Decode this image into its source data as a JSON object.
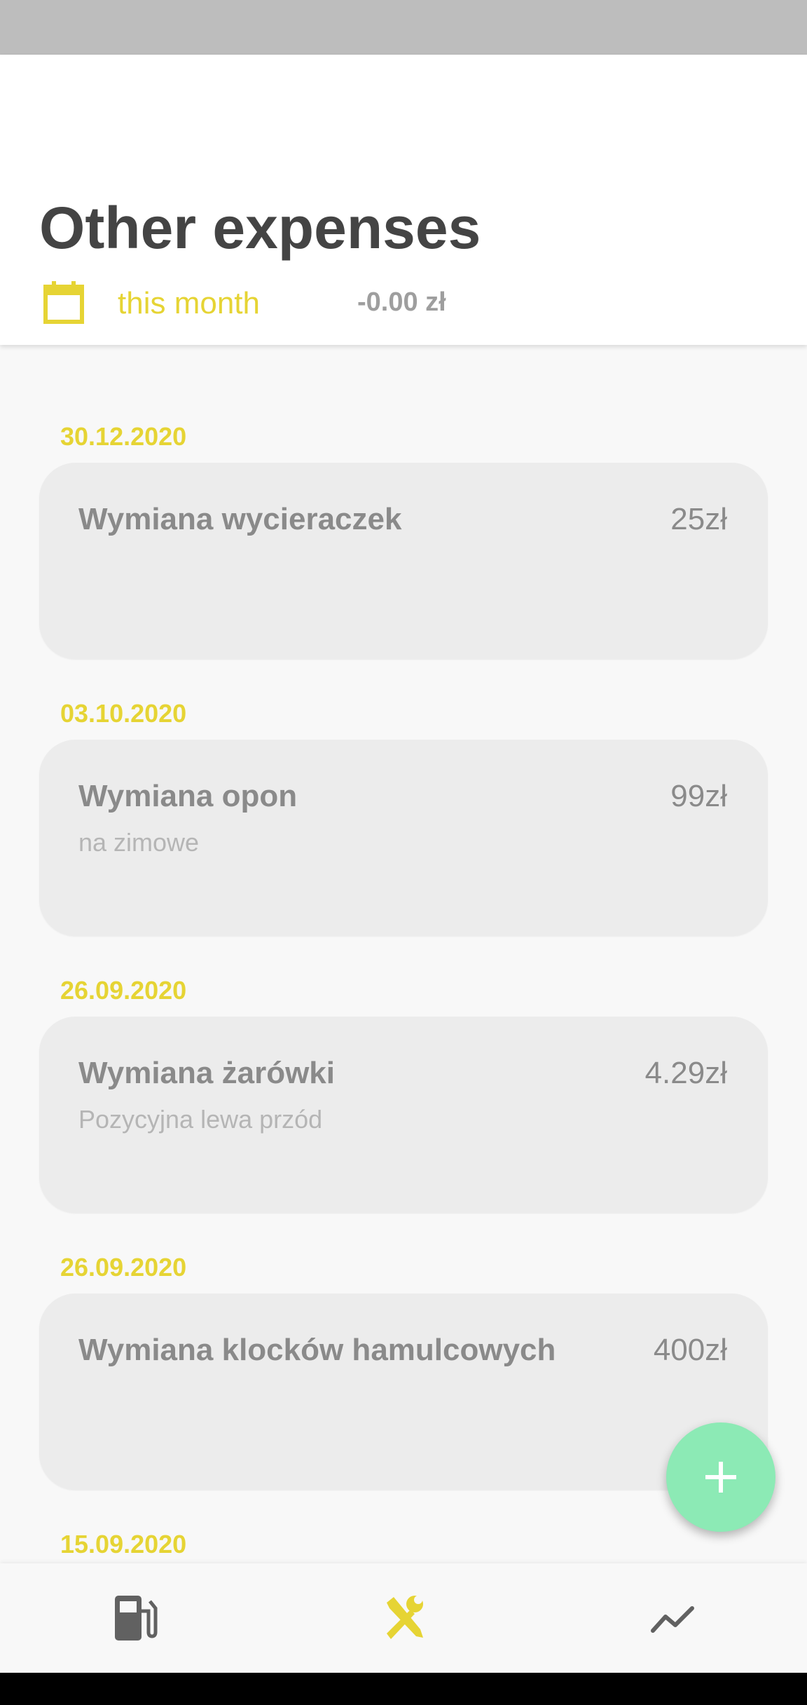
{
  "header": {
    "title": "Other expenses",
    "period": "this month",
    "total": "-0.00 zł"
  },
  "expenses": [
    {
      "date": "30.12.2020",
      "title": "Wymiana wycieraczek",
      "amount": "25zł",
      "note": ""
    },
    {
      "date": "03.10.2020",
      "title": "Wymiana opon",
      "amount": "99zł",
      "note": "na zimowe"
    },
    {
      "date": "26.09.2020",
      "title": "Wymiana żarówki",
      "amount": "4.29zł",
      "note": "Pozycyjna lewa przód"
    },
    {
      "date": "26.09.2020",
      "title": "Wymiana klocków hamulcowych",
      "amount": "400zł",
      "note": ""
    },
    {
      "date": "15.09.2020",
      "title": "",
      "amount": "",
      "note": ""
    }
  ],
  "bottom_nav": [
    {
      "icon": "fuel-pump-icon",
      "active": false
    },
    {
      "icon": "tools-icon",
      "active": true
    },
    {
      "icon": "stats-icon",
      "active": false
    }
  ],
  "colors": {
    "accent": "#e6d434",
    "fab": "#8ceab5",
    "card": "#ececec",
    "title": "#444444",
    "inactive_icon": "#616161"
  }
}
